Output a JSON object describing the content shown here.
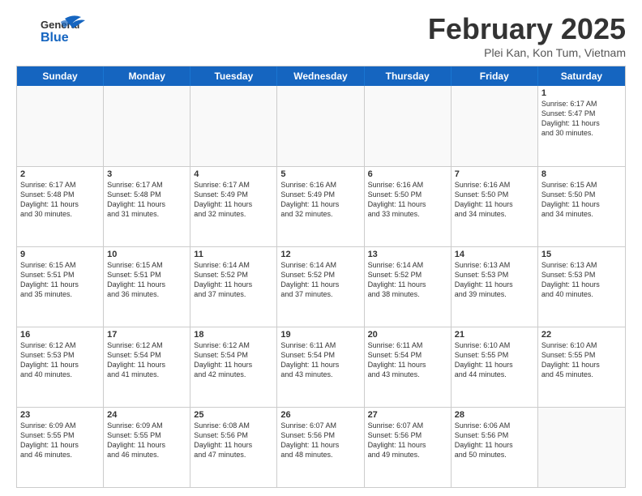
{
  "header": {
    "logo_general": "General",
    "logo_blue": "Blue",
    "month_title": "February 2025",
    "location": "Plei Kan, Kon Tum, Vietnam"
  },
  "days_of_week": [
    "Sunday",
    "Monday",
    "Tuesday",
    "Wednesday",
    "Thursday",
    "Friday",
    "Saturday"
  ],
  "weeks": [
    [
      {
        "day": "",
        "info": "",
        "empty": true
      },
      {
        "day": "",
        "info": "",
        "empty": true
      },
      {
        "day": "",
        "info": "",
        "empty": true
      },
      {
        "day": "",
        "info": "",
        "empty": true
      },
      {
        "day": "",
        "info": "",
        "empty": true
      },
      {
        "day": "",
        "info": "",
        "empty": true
      },
      {
        "day": "1",
        "info": "Sunrise: 6:17 AM\nSunset: 5:47 PM\nDaylight: 11 hours\nand 30 minutes.",
        "empty": false
      }
    ],
    [
      {
        "day": "2",
        "info": "Sunrise: 6:17 AM\nSunset: 5:48 PM\nDaylight: 11 hours\nand 30 minutes.",
        "empty": false
      },
      {
        "day": "3",
        "info": "Sunrise: 6:17 AM\nSunset: 5:48 PM\nDaylight: 11 hours\nand 31 minutes.",
        "empty": false
      },
      {
        "day": "4",
        "info": "Sunrise: 6:17 AM\nSunset: 5:49 PM\nDaylight: 11 hours\nand 32 minutes.",
        "empty": false
      },
      {
        "day": "5",
        "info": "Sunrise: 6:16 AM\nSunset: 5:49 PM\nDaylight: 11 hours\nand 32 minutes.",
        "empty": false
      },
      {
        "day": "6",
        "info": "Sunrise: 6:16 AM\nSunset: 5:50 PM\nDaylight: 11 hours\nand 33 minutes.",
        "empty": false
      },
      {
        "day": "7",
        "info": "Sunrise: 6:16 AM\nSunset: 5:50 PM\nDaylight: 11 hours\nand 34 minutes.",
        "empty": false
      },
      {
        "day": "8",
        "info": "Sunrise: 6:15 AM\nSunset: 5:50 PM\nDaylight: 11 hours\nand 34 minutes.",
        "empty": false
      }
    ],
    [
      {
        "day": "9",
        "info": "Sunrise: 6:15 AM\nSunset: 5:51 PM\nDaylight: 11 hours\nand 35 minutes.",
        "empty": false
      },
      {
        "day": "10",
        "info": "Sunrise: 6:15 AM\nSunset: 5:51 PM\nDaylight: 11 hours\nand 36 minutes.",
        "empty": false
      },
      {
        "day": "11",
        "info": "Sunrise: 6:14 AM\nSunset: 5:52 PM\nDaylight: 11 hours\nand 37 minutes.",
        "empty": false
      },
      {
        "day": "12",
        "info": "Sunrise: 6:14 AM\nSunset: 5:52 PM\nDaylight: 11 hours\nand 37 minutes.",
        "empty": false
      },
      {
        "day": "13",
        "info": "Sunrise: 6:14 AM\nSunset: 5:52 PM\nDaylight: 11 hours\nand 38 minutes.",
        "empty": false
      },
      {
        "day": "14",
        "info": "Sunrise: 6:13 AM\nSunset: 5:53 PM\nDaylight: 11 hours\nand 39 minutes.",
        "empty": false
      },
      {
        "day": "15",
        "info": "Sunrise: 6:13 AM\nSunset: 5:53 PM\nDaylight: 11 hours\nand 40 minutes.",
        "empty": false
      }
    ],
    [
      {
        "day": "16",
        "info": "Sunrise: 6:12 AM\nSunset: 5:53 PM\nDaylight: 11 hours\nand 40 minutes.",
        "empty": false
      },
      {
        "day": "17",
        "info": "Sunrise: 6:12 AM\nSunset: 5:54 PM\nDaylight: 11 hours\nand 41 minutes.",
        "empty": false
      },
      {
        "day": "18",
        "info": "Sunrise: 6:12 AM\nSunset: 5:54 PM\nDaylight: 11 hours\nand 42 minutes.",
        "empty": false
      },
      {
        "day": "19",
        "info": "Sunrise: 6:11 AM\nSunset: 5:54 PM\nDaylight: 11 hours\nand 43 minutes.",
        "empty": false
      },
      {
        "day": "20",
        "info": "Sunrise: 6:11 AM\nSunset: 5:54 PM\nDaylight: 11 hours\nand 43 minutes.",
        "empty": false
      },
      {
        "day": "21",
        "info": "Sunrise: 6:10 AM\nSunset: 5:55 PM\nDaylight: 11 hours\nand 44 minutes.",
        "empty": false
      },
      {
        "day": "22",
        "info": "Sunrise: 6:10 AM\nSunset: 5:55 PM\nDaylight: 11 hours\nand 45 minutes.",
        "empty": false
      }
    ],
    [
      {
        "day": "23",
        "info": "Sunrise: 6:09 AM\nSunset: 5:55 PM\nDaylight: 11 hours\nand 46 minutes.",
        "empty": false
      },
      {
        "day": "24",
        "info": "Sunrise: 6:09 AM\nSunset: 5:55 PM\nDaylight: 11 hours\nand 46 minutes.",
        "empty": false
      },
      {
        "day": "25",
        "info": "Sunrise: 6:08 AM\nSunset: 5:56 PM\nDaylight: 11 hours\nand 47 minutes.",
        "empty": false
      },
      {
        "day": "26",
        "info": "Sunrise: 6:07 AM\nSunset: 5:56 PM\nDaylight: 11 hours\nand 48 minutes.",
        "empty": false
      },
      {
        "day": "27",
        "info": "Sunrise: 6:07 AM\nSunset: 5:56 PM\nDaylight: 11 hours\nand 49 minutes.",
        "empty": false
      },
      {
        "day": "28",
        "info": "Sunrise: 6:06 AM\nSunset: 5:56 PM\nDaylight: 11 hours\nand 50 minutes.",
        "empty": false
      },
      {
        "day": "",
        "info": "",
        "empty": true
      }
    ]
  ]
}
